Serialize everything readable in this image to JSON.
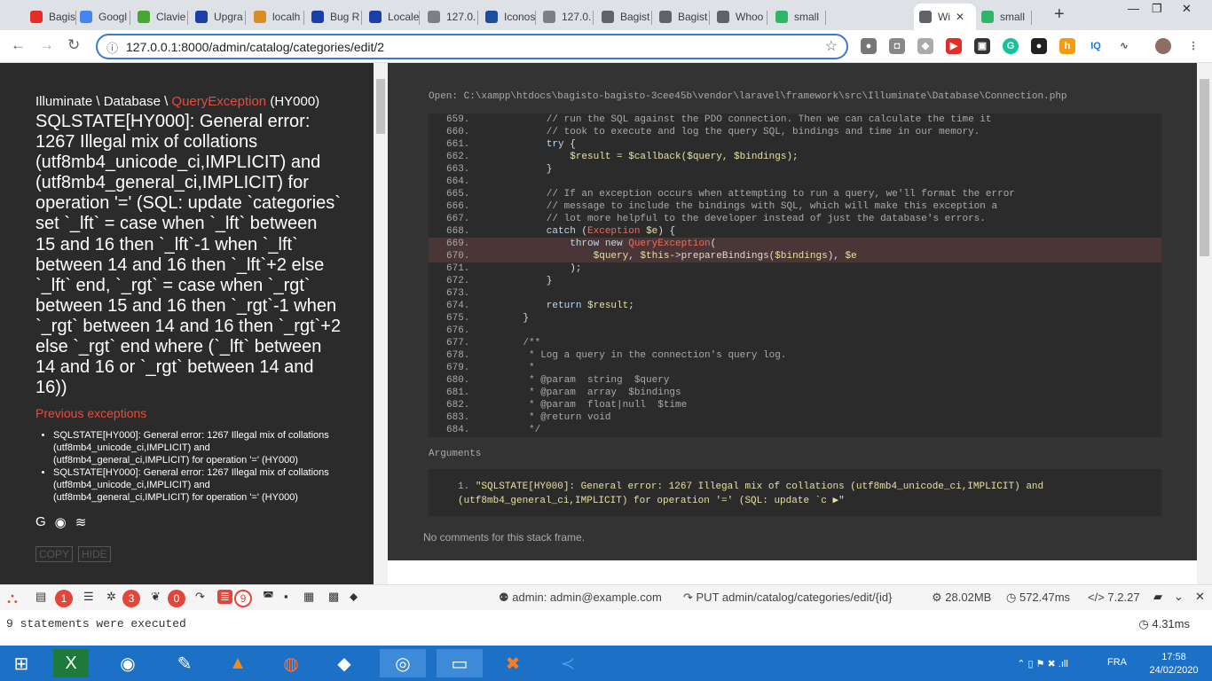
{
  "browser": {
    "tabs": [
      {
        "label": "Bagist",
        "color": "#e52d27"
      },
      {
        "label": "Googl",
        "color": "#4285f4"
      },
      {
        "label": "Clavie",
        "color": "#44a833"
      },
      {
        "label": "Upgra",
        "color": "#1a3fa8"
      },
      {
        "label": "localh",
        "color": "#d98e24"
      },
      {
        "label": "Bug R",
        "color": "#1a3fa8"
      },
      {
        "label": "Locale",
        "color": "#1a3fa8"
      },
      {
        "label": "127.0.",
        "color": "#7c8085"
      },
      {
        "label": "Iconos",
        "color": "#1c4e9e"
      },
      {
        "label": "127.0.",
        "color": "#7c8085"
      },
      {
        "label": "Bagist",
        "color": "#5f6368"
      },
      {
        "label": "Bagist",
        "color": "#5f6368"
      },
      {
        "label": "Whoo",
        "color": "#5f6368"
      },
      {
        "label": "small",
        "color": "#2fb56a"
      },
      {
        "label": "Wi",
        "color": "#5f6368"
      },
      {
        "label": "small",
        "color": "#2fb56a"
      }
    ],
    "url": "127.0.0.1:8000/admin/catalog/categories/edit/2",
    "new_tab": "+",
    "close_tab": "✕"
  },
  "error": {
    "namespace": "Illuminate \\ Database \\ ",
    "exception": "QueryException",
    "code": " (HY000)",
    "message": "SQLSTATE[HY000]: General error: 1267 Illegal mix of collations (utf8mb4_unicode_ci,IMPLICIT) and (utf8mb4_general_ci,IMPLICIT) for operation '=' (SQL: update `categories` set `_lft` = case when `_lft` between 15 and 16 then `_lft`-1 when `_lft` between 14 and 16 then `_lft`+2 else `_lft` end, `_rgt` = case when `_rgt` between 15 and 16 then `_rgt`-1 when `_rgt` between 14 and 16 then `_rgt`+2 else `_rgt` end where (`_lft` between 14 and 16 or `_rgt` between 14 and 16))",
    "previous_heading": "Previous exceptions",
    "previous": [
      {
        "text": "SQLSTATE[HY000]: General error: 1267 Illegal mix of collations (utf8mb4_unicode_ci,IMPLICIT) and (utf8mb4_general_ci,IMPLICIT) for operation '='",
        "code": " (HY000)"
      },
      {
        "text": "SQLSTATE[HY000]: General error: 1267 Illegal mix of collations (utf8mb4_unicode_ci,IMPLICIT) and (utf8mb4_general_ci,IMPLICIT) for operation '='",
        "code": " (HY000)"
      }
    ],
    "copy_label": "COPY",
    "hide_label": "HIDE"
  },
  "frame": {
    "open_label": "Open: C:\\xampp\\htdocs\\bagisto-bagisto-3cee45b\\vendor\\laravel\\framework\\src\\Illuminate\\Database\\Connection.php",
    "arguments_label": "Arguments",
    "argument_index": "1.",
    "argument": "\"SQLSTATE[HY000]: General error: 1267 Illegal mix of collations (utf8mb4_unicode_ci,IMPLICIT) and (utf8mb4_general_ci,IMPLICIT) for operation '=' (SQL: update `c ▶\"",
    "no_comments": "No comments for this stack frame."
  },
  "debugbar": {
    "messages_count": "1",
    "exceptions_count": "3",
    "views_count": "0",
    "queries_count": "9",
    "user": "admin: admin@example.com",
    "route": "PUT admin/catalog/categories/edit/{id}",
    "memory": "28.02MB",
    "time": "572.47ms",
    "php_version": "7.2.27",
    "panel_text": "9 statements were executed",
    "panel_time": "4.31ms"
  },
  "taskbar": {
    "language": "FRA",
    "time": "17:58",
    "date": "24/02/2020"
  }
}
